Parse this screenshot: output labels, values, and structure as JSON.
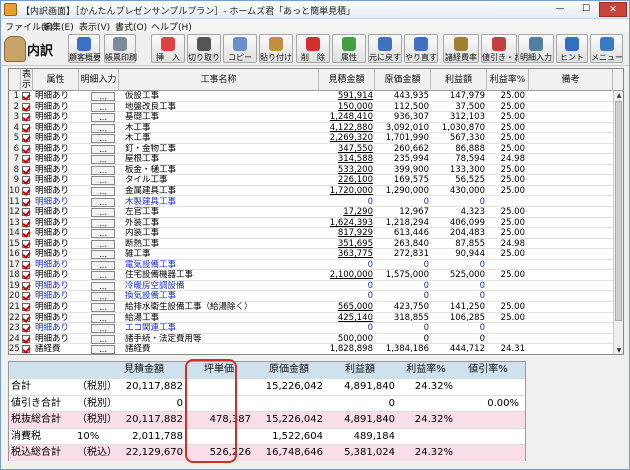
{
  "window": {
    "title": "【内訳画面】［かんたんプレゼンサンプルプラン］- ホームズ君「あっと簡単見積」",
    "minimize": "—",
    "maximize": "☐",
    "close": "✕"
  },
  "menu": [
    "ファイル(F)",
    "編集(E)",
    "表示(V)",
    "書式(O)",
    "ヘルプ(H)"
  ],
  "toolbar": {
    "logo_label": "内訳",
    "buttons": [
      {
        "label": "顧客概要",
        "icon": "customer-icon"
      },
      {
        "label": "帳票印刷",
        "icon": "print-icon"
      },
      {
        "label": "挿　入",
        "icon": "insert-icon"
      },
      {
        "label": "切り取り",
        "icon": "scissors-icon"
      },
      {
        "label": "コピー",
        "icon": "copy-icon"
      },
      {
        "label": "貼り付け",
        "icon": "paste-icon"
      },
      {
        "label": "削　除",
        "icon": "delete-icon"
      },
      {
        "label": "属性",
        "icon": "attribute-icon"
      },
      {
        "label": "元に戻す",
        "icon": "undo-icon"
      },
      {
        "label": "やり直す",
        "icon": "redo-icon"
      },
      {
        "label": "諸経費率",
        "icon": "expense-rate-icon"
      },
      {
        "label": "値引き・お計",
        "icon": "discount-icon"
      },
      {
        "label": "明細入力",
        "icon": "detail-input-icon"
      },
      {
        "label": "ヒント",
        "icon": "hint-icon"
      },
      {
        "label": "メニュー",
        "icon": "menu-icon"
      }
    ]
  },
  "grid": {
    "headers": {
      "display": "表示",
      "attribute": "属性",
      "detail_input": "明細入力",
      "name": "工事名称",
      "estimate": "見積金額",
      "cost": "原価金額",
      "profit": "利益額",
      "profit_rate": "利益率%",
      "note": "備考"
    },
    "rows": [
      {
        "no": "1",
        "attr": "明細あり",
        "name": "仮設工事",
        "est": "591,914",
        "cost": "443,935",
        "profit": "147,979",
        "rate": "25.00",
        "blue": false
      },
      {
        "no": "2",
        "attr": "明細あり",
        "name": "地盤改良工事",
        "est": "150,000",
        "cost": "112,500",
        "profit": "37,500",
        "rate": "25.00",
        "blue": false
      },
      {
        "no": "3",
        "attr": "明細あり",
        "name": "基礎工事",
        "est": "1,248,410",
        "cost": "936,307",
        "profit": "312,103",
        "rate": "25.00",
        "blue": false
      },
      {
        "no": "4",
        "attr": "明細あり",
        "name": "木工事",
        "est": "4,122,880",
        "cost": "3,092,010",
        "profit": "1,030,870",
        "rate": "25.00",
        "blue": false
      },
      {
        "no": "5",
        "attr": "明細あり",
        "name": "木工事",
        "est": "2,269,320",
        "cost": "1,701,990",
        "profit": "567,330",
        "rate": "25.00",
        "blue": false
      },
      {
        "no": "6",
        "attr": "明細あり",
        "name": "釘・金物工事",
        "est": "347,550",
        "cost": "260,662",
        "profit": "86,888",
        "rate": "25.00",
        "blue": false
      },
      {
        "no": "7",
        "attr": "明細あり",
        "name": "屋根工事",
        "est": "314,588",
        "cost": "235,994",
        "profit": "78,594",
        "rate": "24.98",
        "blue": false
      },
      {
        "no": "8",
        "attr": "明細あり",
        "name": "板金・樋工事",
        "est": "533,200",
        "cost": "399,900",
        "profit": "133,300",
        "rate": "25.00",
        "blue": false
      },
      {
        "no": "9",
        "attr": "明細あり",
        "name": "タイル工事",
        "est": "226,100",
        "cost": "169,575",
        "profit": "56,525",
        "rate": "25.00",
        "blue": false
      },
      {
        "no": "10",
        "attr": "明細あり",
        "name": "金属建具工事",
        "est": "1,720,000",
        "cost": "1,290,000",
        "profit": "430,000",
        "rate": "25.00",
        "blue": false
      },
      {
        "no": "11",
        "attr": "明細あり",
        "name": "木製建具工事",
        "est": "0",
        "cost": "0",
        "profit": "0",
        "rate": "",
        "blue": true
      },
      {
        "no": "12",
        "attr": "明細あり",
        "name": "左官工事",
        "est": "17,290",
        "cost": "12,967",
        "profit": "4,323",
        "rate": "25.00",
        "blue": false
      },
      {
        "no": "13",
        "attr": "明細あり",
        "name": "外装工事",
        "est": "1,624,393",
        "cost": "1,218,294",
        "profit": "406,099",
        "rate": "25.00",
        "blue": false
      },
      {
        "no": "14",
        "attr": "明細あり",
        "name": "内装工事",
        "est": "817,929",
        "cost": "613,446",
        "profit": "204,483",
        "rate": "25.00",
        "blue": false
      },
      {
        "no": "15",
        "attr": "明細あり",
        "name": "断熱工事",
        "est": "351,695",
        "cost": "263,840",
        "profit": "87,855",
        "rate": "24.98",
        "blue": false
      },
      {
        "no": "16",
        "attr": "明細あり",
        "name": "雑工事",
        "est": "363,775",
        "cost": "272,831",
        "profit": "90,944",
        "rate": "25.00",
        "blue": false
      },
      {
        "no": "17",
        "attr": "明細あり",
        "name": "電気設備工事",
        "est": "0",
        "cost": "0",
        "profit": "0",
        "rate": "",
        "blue": true
      },
      {
        "no": "18",
        "attr": "明細あり",
        "name": "住宅設備機器工事",
        "est": "2,100,000",
        "cost": "1,575,000",
        "profit": "525,000",
        "rate": "25.00",
        "blue": false
      },
      {
        "no": "19",
        "attr": "明細あり",
        "name": "冷暖房空調設備",
        "est": "0",
        "cost": "0",
        "profit": "0",
        "rate": "",
        "blue": true
      },
      {
        "no": "20",
        "attr": "明細あり",
        "name": "換気設備工事",
        "est": "0",
        "cost": "0",
        "profit": "0",
        "rate": "",
        "blue": true
      },
      {
        "no": "21",
        "attr": "明細あり",
        "name": "給排水衛生設備工事（給湯除く）",
        "est": "565,000",
        "cost": "423,750",
        "profit": "141,250",
        "rate": "25.00",
        "blue": false
      },
      {
        "no": "22",
        "attr": "明細あり",
        "name": "給湯工事",
        "est": "425,140",
        "cost": "318,855",
        "profit": "106,285",
        "rate": "25.00",
        "blue": false
      },
      {
        "no": "23",
        "attr": "明細あり",
        "name": "エコ関連工事",
        "est": "0",
        "cost": "0",
        "profit": "0",
        "rate": "",
        "blue": true
      },
      {
        "no": "24",
        "attr": "明細あり",
        "name": "諸手続・法定費用等",
        "est": "500,000",
        "cost": "0",
        "profit": "0",
        "rate": "",
        "blue": false
      },
      {
        "no": "25",
        "attr": "諸経費",
        "name": "諸経費",
        "est": "1,828,898",
        "cost": "1,384,186",
        "profit": "444,712",
        "rate": "24.31",
        "blue": false
      }
    ]
  },
  "totals": {
    "headers": {
      "estimate": "見積金額",
      "tsubo": "坪単価",
      "cost": "原価金額",
      "profit": "利益額",
      "rate": "利益率%",
      "discount_rate": "値引率%"
    },
    "rows": [
      {
        "label": "合計",
        "tax": "（税別）",
        "est": "20,117,882",
        "tsubo": "",
        "cost": "15,226,042",
        "profit": "4,891,840",
        "rate": "24.32%",
        "drate": "",
        "pink": false
      },
      {
        "label": "値引き合計",
        "tax": "（税別）",
        "est": "0",
        "tsubo": "",
        "cost": "",
        "profit": "0",
        "rate": "",
        "drate": "0.00%",
        "pink": false
      },
      {
        "label": "税抜総合計",
        "tax": "（税別）",
        "est": "20,117,882",
        "tsubo": "478,387",
        "cost": "15,226,042",
        "profit": "4,891,840",
        "rate": "24.32%",
        "drate": "",
        "pink": true
      },
      {
        "label": "消費税",
        "tax": "10%",
        "est": "2,011,788",
        "tsubo": "",
        "cost": "1,522,604",
        "profit": "489,184",
        "rate": "",
        "drate": "",
        "pink": false
      },
      {
        "label": "税込総合計",
        "tax": "（税込）",
        "est": "22,129,670",
        "tsubo": "526,226",
        "cost": "16,748,646",
        "profit": "5,381,024",
        "rate": "24.32%",
        "drate": "",
        "pink": true
      }
    ]
  },
  "colors": {
    "accent": "#1a2fd0",
    "highlight": "#d23020",
    "pink": "#f9dde8",
    "header": "#cfe0ee"
  }
}
